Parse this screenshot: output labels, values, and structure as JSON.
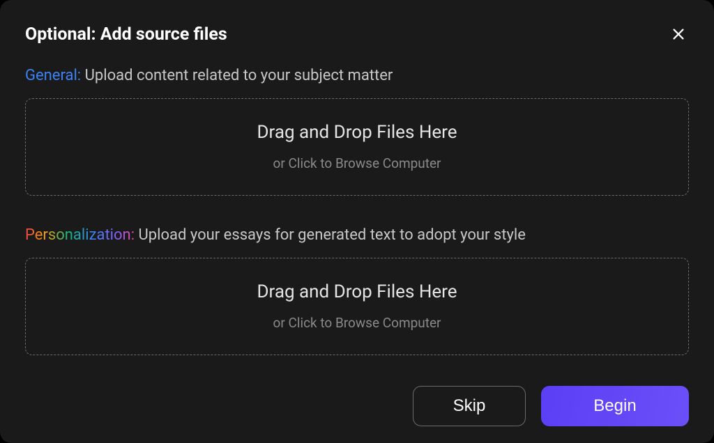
{
  "modal": {
    "title": "Optional: Add source files"
  },
  "sections": {
    "general": {
      "label": "General:",
      "description": " Upload content related to your subject matter",
      "dropzone": {
        "title": "Drag and Drop Files Here",
        "subtitle": "or Click to Browse Computer"
      }
    },
    "personalization": {
      "label": "Personalization:",
      "description": "  Upload your essays for generated text to adopt your style",
      "dropzone": {
        "title": "Drag and Drop Files Here",
        "subtitle": "or Click to Browse Computer"
      }
    }
  },
  "buttons": {
    "skip": "Skip",
    "begin": "Begin"
  }
}
